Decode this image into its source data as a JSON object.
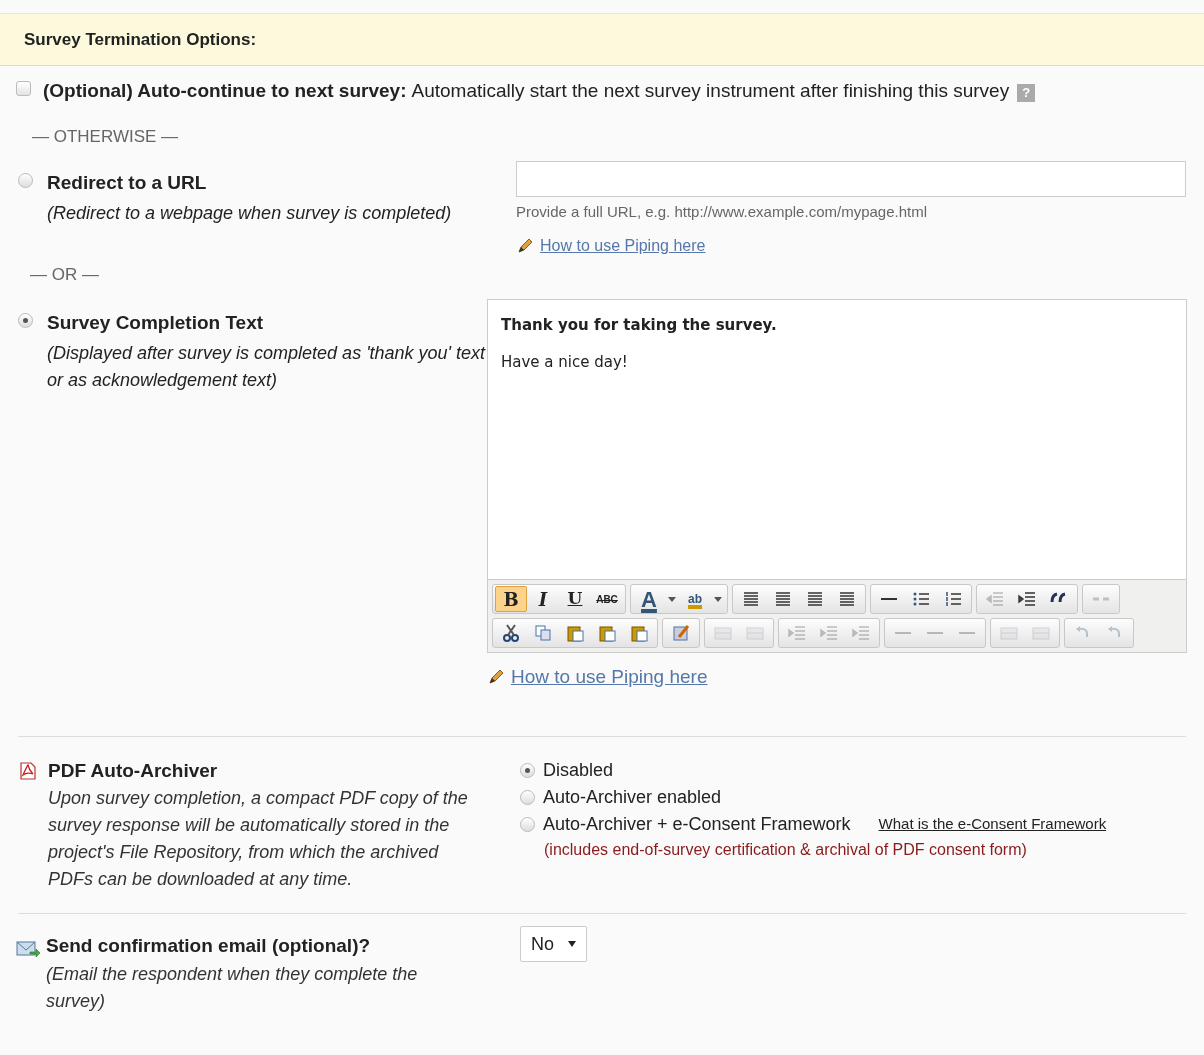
{
  "header": {
    "title": "Survey Termination Options:"
  },
  "auto_continue": {
    "checked": false,
    "label": "(Optional) Auto-continue to next survey:",
    "description": "Automatically start the next survey instrument after finishing this survey",
    "help": "?"
  },
  "separator_1": "— OTHERWISE —",
  "redirect": {
    "selected": false,
    "label": "Redirect to a URL",
    "description": "(Redirect to a webpage when survey is completed)",
    "hint": "Provide a full URL, e.g. http://www.example.com/mypage.html",
    "piping_link": "How to use Piping here"
  },
  "separator_2": "— OR —",
  "completion": {
    "selected": true,
    "label": "Survey Completion Text",
    "description": "(Displayed after survey is completed as 'thank you' text or as acknowledgement text)",
    "editor_lines": [
      {
        "text": "Thank you for taking the survey.",
        "bold": true
      },
      {
        "text": "Have a nice day!",
        "bold": false
      }
    ],
    "toolbar": [
      [
        [
          {
            "kind": "letter",
            "label": "B",
            "active": true
          },
          {
            "kind": "letter",
            "label": "I",
            "active": false
          },
          {
            "kind": "letter",
            "label": "U",
            "active": false
          },
          {
            "kind": "letter",
            "label": "ABC",
            "active": false
          }
        ],
        [
          {
            "kind": "letter",
            "label": "A",
            "active": false
          },
          {
            "kind": "dropdown",
            "active": false
          },
          {
            "kind": "letter",
            "label": "ab",
            "active": false
          },
          {
            "kind": "dropdown",
            "active": false
          }
        ],
        [
          {
            "kind": "align",
            "active": false
          },
          {
            "kind": "align",
            "active": false
          },
          {
            "kind": "align",
            "active": false
          },
          {
            "kind": "align",
            "active": false
          }
        ],
        [
          {
            "kind": "rule",
            "active": false
          },
          {
            "kind": "bullets",
            "active": false
          },
          {
            "kind": "numbers",
            "active": false
          }
        ],
        [
          {
            "kind": "outdent",
            "active": false,
            "disabled": true
          },
          {
            "kind": "indent",
            "active": false
          },
          {
            "kind": "quote",
            "active": false
          }
        ],
        [
          {
            "kind": "link",
            "active": false,
            "disabled": true
          }
        ]
      ],
      [
        [
          {
            "kind": "cut",
            "active": false
          },
          {
            "kind": "copy",
            "active": false
          },
          {
            "kind": "paste",
            "active": false
          },
          {
            "kind": "paste",
            "active": false
          },
          {
            "kind": "paste",
            "active": false
          }
        ],
        [
          {
            "kind": "template",
            "active": false
          }
        ],
        [
          {
            "kind": "table",
            "active": false,
            "disabled": true
          },
          {
            "kind": "table",
            "active": false,
            "disabled": true
          }
        ],
        [
          {
            "kind": "indent",
            "active": false,
            "disabled": true
          },
          {
            "kind": "indent",
            "active": false,
            "disabled": true
          },
          {
            "kind": "indent",
            "active": false,
            "disabled": true
          }
        ],
        [
          {
            "kind": "rule",
            "active": false,
            "disabled": true
          },
          {
            "kind": "rule",
            "active": false,
            "disabled": true
          },
          {
            "kind": "rule",
            "active": false,
            "disabled": true
          }
        ],
        [
          {
            "kind": "table",
            "active": false,
            "disabled": true
          },
          {
            "kind": "table",
            "active": false,
            "disabled": true
          }
        ],
        [
          {
            "kind": "undo",
            "active": false,
            "disabled": true
          },
          {
            "kind": "undo",
            "active": false,
            "disabled": true
          }
        ]
      ]
    ],
    "piping_link": "How to use Piping here"
  },
  "pdf_archiver": {
    "label": "PDF Auto-Archiver",
    "description": "Upon survey completion, a compact PDF copy of the survey response will be automatically stored in the project's File Repository, from which the archived PDFs can be downloaded at any time.",
    "options": [
      {
        "label": "Disabled",
        "selected": true
      },
      {
        "label": "Auto-Archiver enabled",
        "selected": false
      },
      {
        "label": "Auto-Archiver + e-Consent Framework",
        "selected": false,
        "link": "What is the e-Consent Framework",
        "note": "(includes end-of-survey certification & archival of PDF consent form)"
      }
    ]
  },
  "confirmation_email": {
    "label": "Send confirmation email (optional)?",
    "description": "(Email the respondent when they complete the survey)",
    "value": "No"
  }
}
